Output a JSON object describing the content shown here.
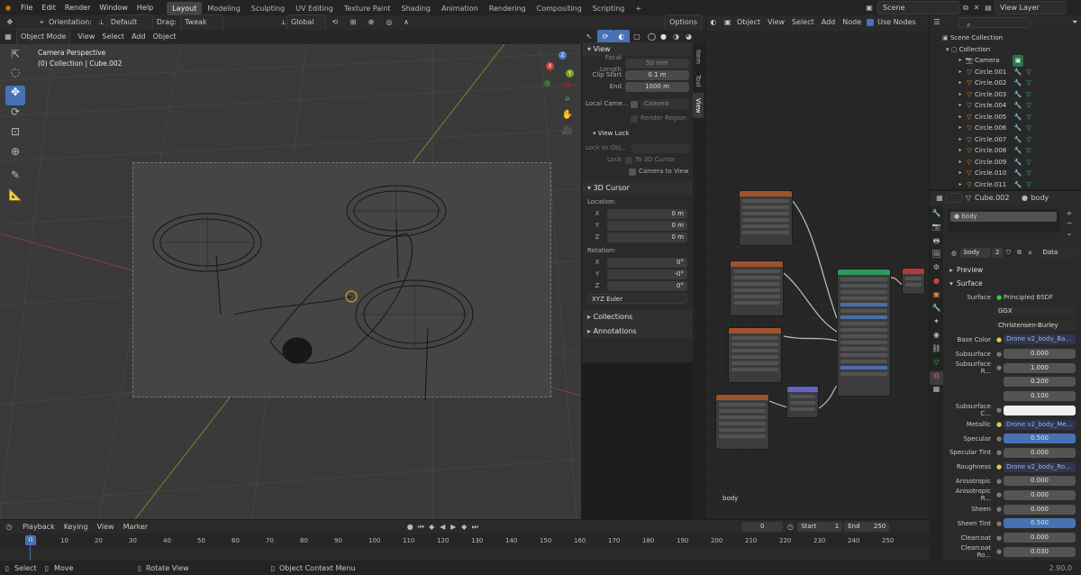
{
  "topbar": {
    "menus": [
      "File",
      "Edit",
      "Render",
      "Window",
      "Help"
    ],
    "workspaces": [
      "Layout",
      "Modeling",
      "Sculpting",
      "UV Editing",
      "Texture Paint",
      "Shading",
      "Animation",
      "Rendering",
      "Compositing",
      "Scripting"
    ],
    "active_workspace": "Layout",
    "add_tab": "+",
    "scene": "Scene",
    "view_layer": "View Layer"
  },
  "tool_header": {
    "orientation_label": "Orientation:",
    "orientation_value": "Default",
    "drag_label": "Drag:",
    "drag_value": "Tweak",
    "transform_orientation": "Global",
    "options": "Options"
  },
  "viewport_header": {
    "mode": "Object Mode",
    "menus": [
      "View",
      "Select",
      "Add",
      "Object"
    ]
  },
  "viewport": {
    "info_line1": "Camera Perspective",
    "info_line2": "(0) Collection | Cube.002",
    "gizmo_x": "X",
    "gizmo_y": "Y",
    "gizmo_z": "Z"
  },
  "npanel": {
    "tabs": [
      "Item",
      "Tool",
      "View"
    ],
    "view_title": "View",
    "focal_length_label": "Focal Length",
    "focal_length": "50 mm",
    "clip_start_label": "Clip Start",
    "clip_start": "0.1 m",
    "end_label": "End",
    "end": "1000 m",
    "local_camera_label": "Local Came...",
    "local_camera": "Camera",
    "render_region": "Render Region",
    "view_lock_title": "View Lock",
    "lock_to_obj_label": "Lock to Obj...",
    "lock_label": "Lock",
    "to_3d_cursor": "To 3D Cursor",
    "camera_to_view": "Camera to View",
    "cursor_title": "3D Cursor",
    "location_label": "Location:",
    "loc": [
      {
        "axis": "X",
        "value": "0 m"
      },
      {
        "axis": "Y",
        "value": "0 m"
      },
      {
        "axis": "Z",
        "value": "0 m"
      }
    ],
    "rotation_label": "Rotation:",
    "rot": [
      {
        "axis": "X",
        "value": "0°"
      },
      {
        "axis": "Y",
        "value": "-0°"
      },
      {
        "axis": "Z",
        "value": "0°"
      }
    ],
    "rotation_mode": "XYZ Euler",
    "collections": "Collections",
    "annotations": "Annotations"
  },
  "node_editor": {
    "object_label": "Object",
    "menus": [
      "View",
      "Select",
      "Add",
      "Node"
    ],
    "use_nodes": "Use Nodes",
    "material_label": "body"
  },
  "outliner": {
    "scene_collection": "Scene Collection",
    "collection": "Collection",
    "items": [
      "Camera",
      "Circle.001",
      "Circle.002",
      "Circle.003",
      "Circle.004",
      "Circle.005",
      "Circle.006",
      "Circle.007",
      "Circle.008",
      "Circle.009",
      "Circle.010",
      "Circle.011"
    ]
  },
  "properties": {
    "object_name": "Cube.002",
    "material_name": "body",
    "slot_name": "body",
    "slot_material": "body",
    "users": "2",
    "data_label": "Data",
    "preview": "Preview",
    "surface": "Surface",
    "surface_label": "Surface",
    "surface_value": "Principled BSDF",
    "distribution": "GGX",
    "subsurface_method": "Christensen-Burley",
    "rows": [
      {
        "label": "Base Color",
        "value": "Drone v2_body_Ba...",
        "kind": "link"
      },
      {
        "label": "Subsurface",
        "value": "0.000",
        "kind": "num"
      },
      {
        "label": "Subsurface R...",
        "value": "1.000",
        "kind": "num"
      },
      {
        "label": "",
        "value": "0.200",
        "kind": "num"
      },
      {
        "label": "",
        "value": "0.100",
        "kind": "num"
      },
      {
        "label": "Subsurface C...",
        "value": "",
        "kind": "color"
      },
      {
        "label": "Metallic",
        "value": "Drone v2_body_Me...",
        "kind": "link"
      },
      {
        "label": "Specular",
        "value": "0.500",
        "kind": "blue"
      },
      {
        "label": "Specular Tint",
        "value": "0.000",
        "kind": "num"
      },
      {
        "label": "Roughness",
        "value": "Drone v2_body_Ro...",
        "kind": "link"
      },
      {
        "label": "Anisotropic",
        "value": "0.000",
        "kind": "num"
      },
      {
        "label": "Anisotropic R...",
        "value": "0.000",
        "kind": "num"
      },
      {
        "label": "Sheen",
        "value": "0.000",
        "kind": "num"
      },
      {
        "label": "Sheen Tint",
        "value": "0.500",
        "kind": "blue"
      },
      {
        "label": "Clearcoat",
        "value": "0.000",
        "kind": "num"
      },
      {
        "label": "Clearcoat Ro...",
        "value": "0.030",
        "kind": "num"
      }
    ]
  },
  "timeline": {
    "menus": [
      "Playback",
      "Keying",
      "View",
      "Marker"
    ],
    "current_frame": "0",
    "start_label": "Start",
    "start": "1",
    "end_label": "End",
    "end": "250",
    "frame_indicator": "0",
    "ticks": [
      "10",
      "20",
      "30",
      "40",
      "50",
      "60",
      "70",
      "80",
      "90",
      "100",
      "110",
      "120",
      "130",
      "140",
      "150",
      "160",
      "170",
      "180",
      "190",
      "200",
      "210",
      "220",
      "230",
      "240",
      "250"
    ]
  },
  "statusbar": {
    "select": "Select",
    "move": "Move",
    "rotate_view": "Rotate View",
    "context_menu": "Object Context Menu",
    "version": "2.90.0"
  },
  "colors": {
    "accent": "#4772b3",
    "select_orange": "#f5a623"
  }
}
